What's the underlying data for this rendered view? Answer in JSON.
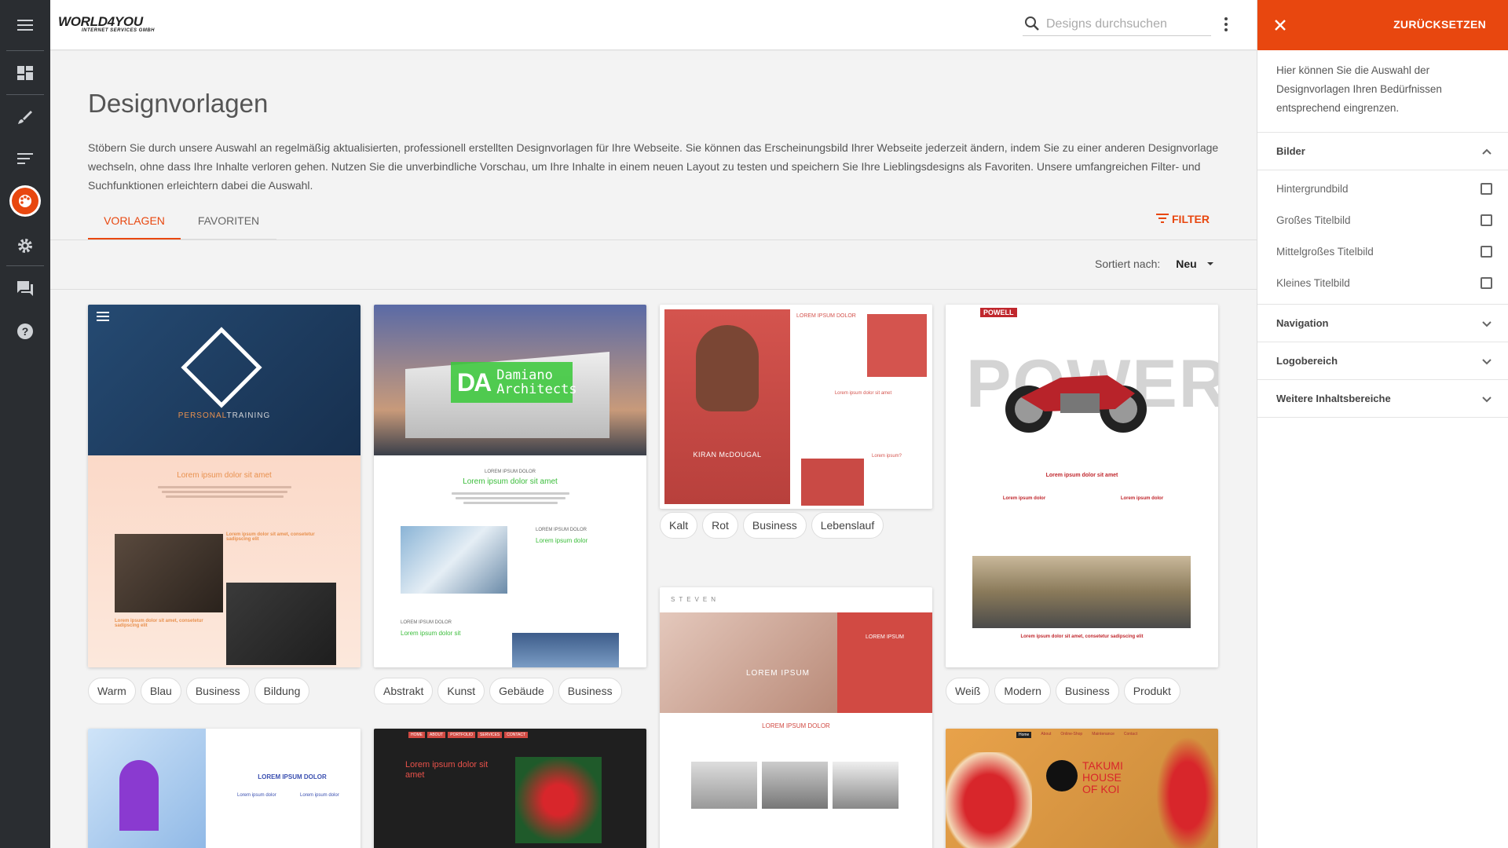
{
  "app": {
    "brand": "WORLD4YOU",
    "brand_sub": "INTERNET SERVICES GMBH",
    "accent": "#e8470f"
  },
  "search": {
    "placeholder": "Designs durchsuchen"
  },
  "sidebar_icons": [
    "menu-icon",
    "dashboard-icon",
    "brush-icon",
    "text-icon",
    "palette-icon",
    "gear-icon",
    "chat-icon",
    "help-icon"
  ],
  "main": {
    "title": "Designvorlagen",
    "description": "Stöbern Sie durch unsere Auswahl an regelmäßig aktualisierten, professionell erstellten Designvorlagen für Ihre Webseite. Sie können das Erscheinungsbild Ihrer Webseite jederzeit ändern, indem Sie zu einer anderen Designvorlage wechseln, ohne dass Ihre Inhalte verloren gehen. Nutzen Sie die unverbindliche Vorschau, um Ihre Inhalte in einem neuen Layout zu testen und speichern Sie Ihre Lieblingsdesigns als Favoriten. Unsere umfangreichen Filter- und Suchfunktionen erleichtern dabei die Auswahl.",
    "tabs": [
      {
        "label": "VORLAGEN",
        "active": true
      },
      {
        "label": "FAVORITEN",
        "active": false
      }
    ],
    "filter_label": "FILTER",
    "sort_label": "Sortiert nach:",
    "sort_value": "Neu"
  },
  "cards": [
    {
      "tags": [
        "Warm",
        "Blau",
        "Business",
        "Bildung"
      ],
      "hero_title": "PERSONAL",
      "hero_title2": "TRAINING",
      "heading": "Lorem ipsum dolor sit amet",
      "sub1": "Lorem ipsum dolor sit amet, consetetur sadipscing elit",
      "sub2": "Lorem ipsum dolor sit amet, consetetur sadipscing elit"
    },
    {
      "tags": [
        "Abstrakt",
        "Kunst",
        "Gebäude",
        "Business"
      ],
      "logo_letters": "DA",
      "logo_name": "Damiano",
      "logo_name2": "Architects",
      "kicker": "LOREM IPSUM DOLOR",
      "heading": "Lorem ipsum dolor sit amet",
      "kicker2": "LOREM IPSUM DOLOR",
      "sub": "Lorem ipsum dolor",
      "kicker3": "LOREM IPSUM DOLOR",
      "sub2": "Lorem ipsum dolor sit"
    },
    {
      "tags": [
        "Kalt",
        "Rot",
        "Business",
        "Lebenslauf"
      ],
      "name": "KIRAN McDOUGAL",
      "heading": "LOREM IPSUM DOLOR",
      "sub": "Lorem ipsum dolor sit amet",
      "sub2": "Lorem ipsum?"
    },
    {
      "tags": [
        "Weiß",
        "Modern",
        "Business",
        "Produkt"
      ],
      "brand": "POWELL",
      "headline": "POWER",
      "heading": "Lorem ipsum dolor sit amet",
      "col1": "Lorem ipsum dolor",
      "col2": "Lorem ipsum dolor",
      "footer": "Lorem ipsum dolor sit amet, consetetur sadipscing elit"
    },
    {
      "brand": "STEVEN",
      "side_title": "LOREM IPSUM",
      "overlay": "LOREM IPSUM",
      "heading": "LOREM IPSUM DOLOR"
    },
    {
      "heading": "LOREM IPSUM DOLOR",
      "col1": "Lorem ipsum dolor",
      "col2": "Lorem ipsum dolor"
    },
    {
      "nav": [
        "HOME",
        "ABOUT",
        "PORTFOLIO",
        "SERVICES",
        "CONTACT"
      ],
      "heading": "Lorem ipsum dolor sit amet"
    },
    {
      "nav": [
        "Home",
        "About",
        "Online-Shop",
        "Maintenance",
        "Contact"
      ],
      "title1": "TAKUMI",
      "title2": "HOUSE",
      "title3": "OF KOI"
    }
  ],
  "filter_panel": {
    "reset_label": "ZURÜCKSETZEN",
    "intro": "Hier können Sie die Auswahl der Designvorlagen Ihren Bedürfnissen entsprechend eingrenzen.",
    "sections": [
      {
        "label": "Bilder",
        "expanded": true,
        "options": [
          "Hintergrundbild",
          "Großes Titelbild",
          "Mittelgroßes Titelbild",
          "Kleines Titelbild"
        ]
      },
      {
        "label": "Navigation",
        "expanded": false
      },
      {
        "label": "Logobereich",
        "expanded": false
      },
      {
        "label": "Weitere Inhaltsbereiche",
        "expanded": false
      }
    ]
  }
}
